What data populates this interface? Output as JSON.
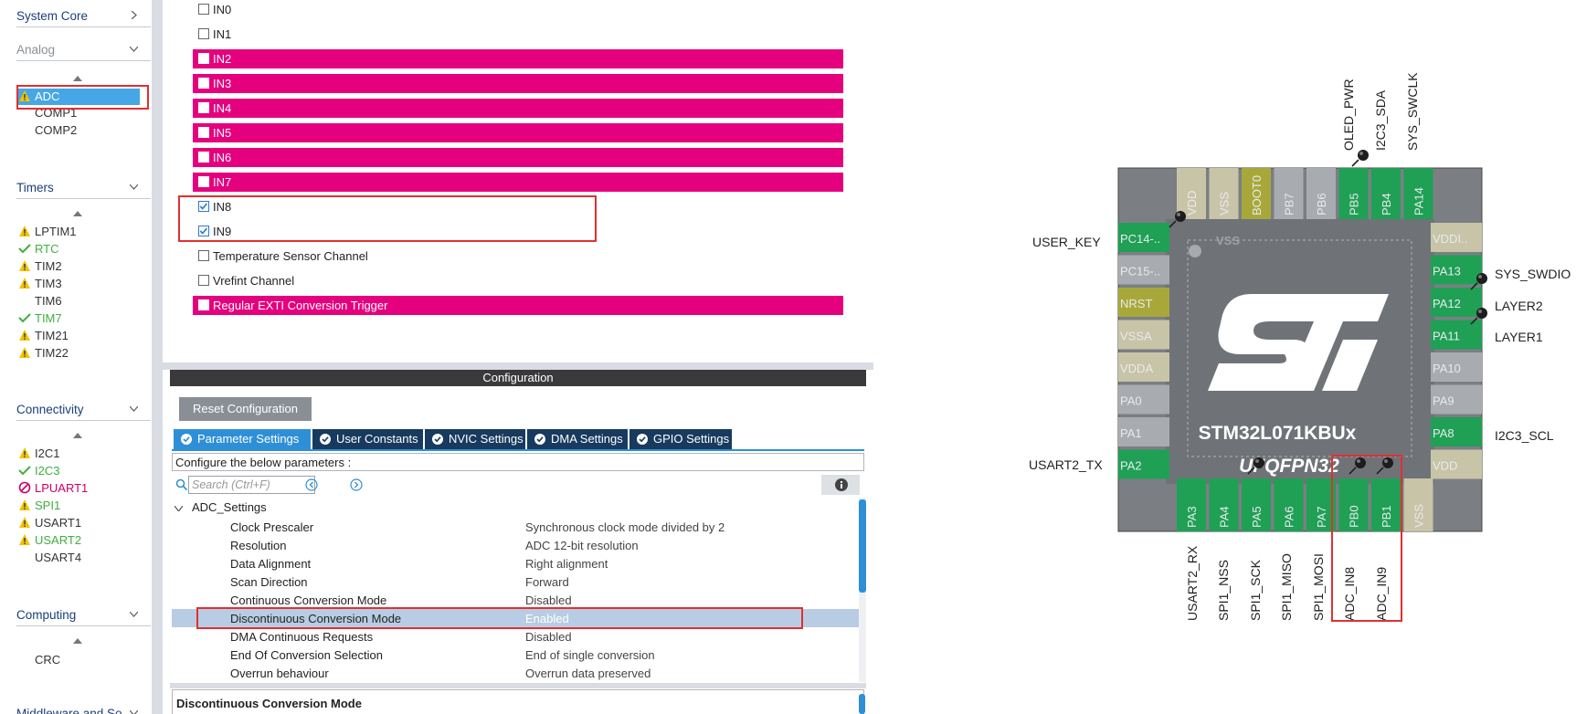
{
  "sidebar": {
    "categories": [
      {
        "label": "System Core"
      },
      {
        "label": "Analog"
      },
      {
        "label": "Timers"
      },
      {
        "label": "Connectivity"
      },
      {
        "label": "Computing"
      },
      {
        "label": "Middleware and So..."
      }
    ],
    "analog_items": [
      "ADC",
      "COMP1",
      "COMP2"
    ],
    "timer_items": [
      "LPTIM1",
      "RTC",
      "TIM2",
      "TIM3",
      "TIM6",
      "TIM7",
      "TIM21",
      "TIM22"
    ],
    "connectivity_items": [
      "I2C1",
      "I2C3",
      "LPUART1",
      "SPI1",
      "USART1",
      "USART2",
      "USART4"
    ],
    "computing_items": [
      "CRC"
    ]
  },
  "channels": [
    {
      "label": "IN0",
      "checked": false,
      "highlighted": false
    },
    {
      "label": "IN1",
      "checked": false,
      "highlighted": false
    },
    {
      "label": "IN2",
      "checked": false,
      "highlighted": true
    },
    {
      "label": "IN3",
      "checked": false,
      "highlighted": true
    },
    {
      "label": "IN4",
      "checked": false,
      "highlighted": true
    },
    {
      "label": "IN5",
      "checked": false,
      "highlighted": true
    },
    {
      "label": "IN6",
      "checked": false,
      "highlighted": true
    },
    {
      "label": "IN7",
      "checked": false,
      "highlighted": true
    },
    {
      "label": "IN8",
      "checked": true,
      "highlighted": false
    },
    {
      "label": "IN9",
      "checked": true,
      "highlighted": false
    },
    {
      "label": "Temperature Sensor Channel",
      "checked": false,
      "highlighted": false
    },
    {
      "label": "Vrefint Channel",
      "checked": false,
      "highlighted": false
    },
    {
      "label": "Regular EXTI Conversion Trigger",
      "checked": false,
      "highlighted": true
    }
  ],
  "config": {
    "title": "Configuration",
    "reset_label": "Reset Configuration",
    "tabs": [
      "Parameter Settings",
      "User Constants",
      "NVIC Settings",
      "DMA Settings",
      "GPIO Settings"
    ],
    "hint": "Configure the below parameters :",
    "search_placeholder": "Search (Ctrl+F)",
    "group": "ADC_Settings",
    "params": [
      {
        "name": "Clock Prescaler",
        "value": "Synchronous clock mode divided by 2"
      },
      {
        "name": "Resolution",
        "value": "ADC 12-bit resolution"
      },
      {
        "name": "Data Alignment",
        "value": "Right alignment"
      },
      {
        "name": "Scan Direction",
        "value": "Forward"
      },
      {
        "name": "Continuous Conversion Mode",
        "value": "Disabled"
      },
      {
        "name": "Discontinuous Conversion Mode",
        "value": "Enabled"
      },
      {
        "name": "DMA Continuous Requests",
        "value": "Disabled"
      },
      {
        "name": "End Of Conversion Selection",
        "value": "End of single conversion"
      },
      {
        "name": "Overrun behaviour",
        "value": "Overrun data preserved"
      }
    ],
    "selected_param": 5,
    "description_title": "Discontinuous Conversion Mode"
  },
  "chip": {
    "part": "STM32L071KBUx",
    "package": "UFQFPN32",
    "vss_label": "VSS",
    "top_pins": [
      "VDD",
      "VSS",
      "BOOT0",
      "PB7",
      "PB6",
      "PB5",
      "PB4",
      "PA14"
    ],
    "bottom_pins": [
      "PA3",
      "PA4",
      "PA5",
      "PA6",
      "PA7",
      "PB0",
      "PB1",
      "VSS"
    ],
    "left_pins": [
      "PC14-..",
      "PC15-..",
      "NRST",
      "VSSA",
      "VDDA",
      "PA0",
      "PA1",
      "PA2"
    ],
    "right_pins": [
      "VDDI..",
      "PA13",
      "PA12",
      "PA11",
      "PA10",
      "PA9",
      "PA8",
      "VDD"
    ],
    "top_labels": [
      "OLED_PWR",
      "I2C3_SDA",
      "SYS_SWCLK"
    ],
    "bottom_labels": [
      "USART2_RX",
      "SPI1_NSS",
      "SPI1_SCK",
      "SPI1_MISO",
      "SPI1_MOSI",
      "ADC_IN8",
      "ADC_IN9"
    ],
    "left_labels": [
      "USER_KEY",
      "USART2_TX"
    ],
    "right_labels": [
      "SYS_SWDIO",
      "LAYER2",
      "LAYER1",
      "I2C3_SCL"
    ]
  },
  "colors": {
    "accent": "#2e8fd6",
    "highlight": "#e5007e",
    "pin_green": "#1fa055",
    "pin_gray": "#a8acb1",
    "pin_tan": "#c8c4a8",
    "pin_olive": "#a8a83a",
    "warning": "#f2c300",
    "ok": "#3fae3f",
    "error": "#cc0066"
  }
}
